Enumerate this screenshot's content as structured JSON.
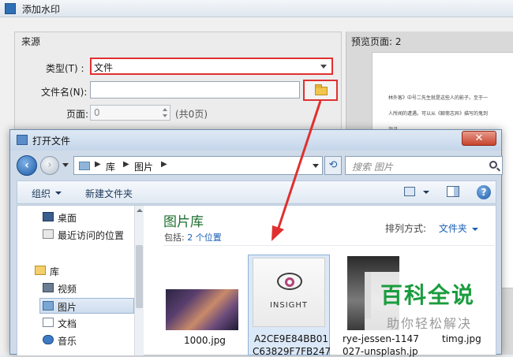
{
  "bg_window": {
    "title": "添加水印",
    "source_legend": "来源",
    "type_label": "类型(T) :",
    "type_value": "文件",
    "filename_label": "文件名(N):",
    "filename_value": "",
    "page_label": "页面:",
    "page_value": "0",
    "page_total": "(共0页)",
    "preview_title": "预览页面: 2",
    "preview_lines": [
      "林外客》中号二先生就是这些人的影子。至于一",
      "人所闻的遭遇。可以从《聊斋志异》描写的鬼到",
      "诣己。"
    ]
  },
  "dialog": {
    "title": "打开文件",
    "close_label": "✕",
    "address_crumbs": [
      "库",
      "图片"
    ],
    "search_placeholder": "搜索 图片",
    "toolbar": {
      "organize": "组织",
      "new_folder": "新建文件夹"
    },
    "nav_items": [
      {
        "label": "桌面",
        "icon": "desktop-icon"
      },
      {
        "label": "最近访问的位置",
        "icon": "recent-places-icon"
      },
      {
        "label": "库",
        "icon": "library-icon"
      },
      {
        "label": "视频",
        "icon": "videos-icon"
      },
      {
        "label": "图片",
        "icon": "pictures-icon",
        "selected": true
      },
      {
        "label": "文档",
        "icon": "documents-icon"
      },
      {
        "label": "音乐",
        "icon": "music-icon"
      }
    ],
    "library_title": "图片库",
    "library_includes": "包括:",
    "library_locations": "2 个位置",
    "arrange_label": "排列方式:",
    "arrange_value": "文件夹",
    "files": [
      {
        "name_lines": [
          "1000.jpg"
        ]
      },
      {
        "name_lines": [
          "A2CE9E84BB01",
          "C63829F7FB247"
        ],
        "thumb_text": "INSIGHT"
      },
      {
        "name_lines": [
          "rye-jessen-1147",
          "027-unsplash.jp"
        ]
      },
      {
        "name_lines": [
          "timg.jpg"
        ]
      }
    ]
  },
  "watermark": {
    "big": "百科全说",
    "small": "助你轻松解决"
  },
  "colors": {
    "highlight_red": "#e03030",
    "library_green": "#1e6e2e",
    "link_blue": "#1a5fb4",
    "watermark_green": "#1a9c3e"
  }
}
